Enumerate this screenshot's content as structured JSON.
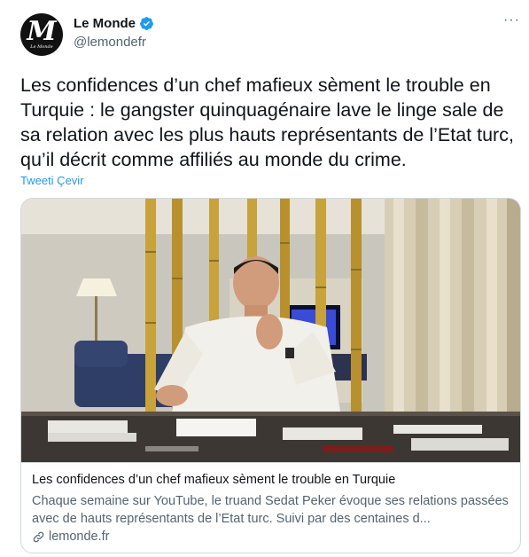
{
  "author": {
    "display_name": "Le Monde",
    "handle": "@lemondefr",
    "avatar_letter": "M",
    "avatar_caption": "Le Monde",
    "verified": true
  },
  "tweet": {
    "text": "Les confidences d’un chef mafieux sèment le trouble en Turquie : le gangster quinquagénaire lave le linge sale de sa relation avec les plus hauts représentants de l’Etat turc, qu’il décrit comme affiliés au monde du crime.",
    "translate_label": "Tweeti Çevir",
    "more_label": "···"
  },
  "card": {
    "title": "Les confidences d’un chef mafieux sèment le trouble en Turquie",
    "description": "Chaque semaine sur YouTube, le truand Sedat Peker évoque ses relations passées avec de hauts représentants de l’Etat turc. Suivi par des centaines d...",
    "domain": "lemonde.fr"
  },
  "colors": {
    "accent": "#1d9bf0",
    "text": "#0f1419",
    "secondary": "#536471",
    "border": "#cfd9de"
  }
}
